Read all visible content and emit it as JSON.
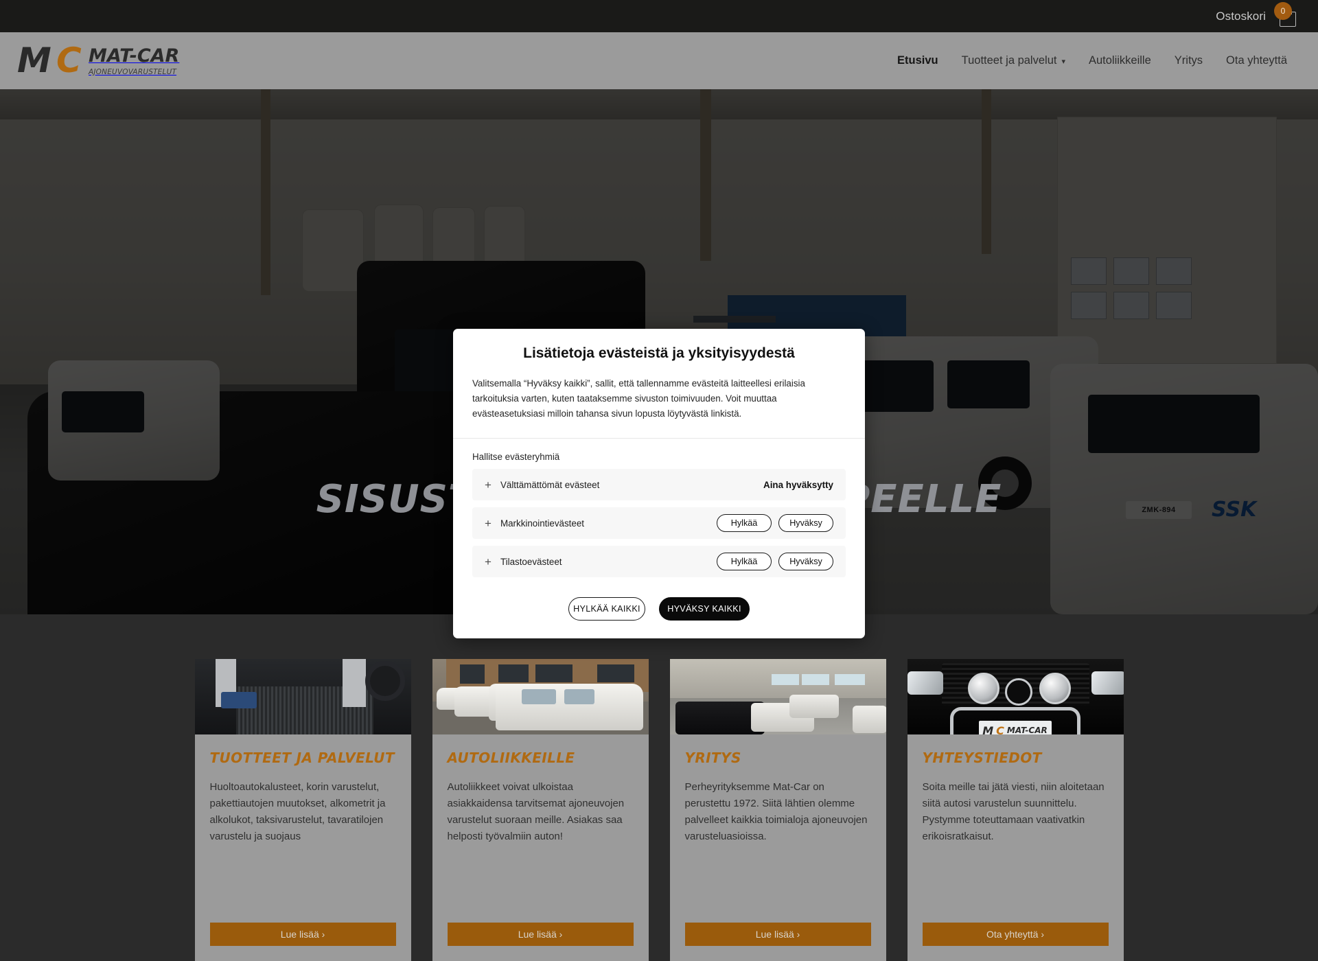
{
  "topbar": {
    "cart_label": "Ostoskori",
    "cart_count": "0",
    "cart_icon": "shopping-bag-icon",
    "background": "#1a1a18",
    "badge_color": "#a25b10"
  },
  "header": {
    "logo": {
      "mark_m": "M",
      "mark_c": "C",
      "name": "MAT-CAR",
      "tagline": "AJONEUVOVARUSTELUT",
      "accent": "#b06a12"
    },
    "background": "#9b9b9b",
    "nav": [
      {
        "label": "Etusivu",
        "active": true,
        "has_dropdown": false
      },
      {
        "label": "Tuotteet ja palvelut",
        "active": false,
        "has_dropdown": true
      },
      {
        "label": "Autoliikkeille",
        "active": false,
        "has_dropdown": false
      },
      {
        "label": "Yritys",
        "active": false,
        "has_dropdown": false
      },
      {
        "label": "Ota yhteyttä",
        "active": false,
        "has_dropdown": false
      }
    ],
    "chevron_icon": "chevron-down-icon"
  },
  "hero": {
    "title_visible_left": "SIS",
    "title_visible_right": "LLE",
    "title_full": "SISUSTUKSET JOKA TARPEELLE",
    "van_plate": "ZMK-894",
    "van_brand_text": "SSK",
    "overlay_color": "rgba(0,0,0,0.70)"
  },
  "cookie_dialog": {
    "title": "Lisätietoja evästeistä ja yksityisyydestä",
    "body": "Valitsemalla “Hyväksy kaikki”, sallit, että tallennamme evästeitä laitteellesi erilaisia tarkoituksia varten, kuten taataksemme sivuston toimivuuden. Voit muuttaa evästeasetuksiasi milloin tahansa sivun lopusta löytyvästä linkistä.",
    "manage_label": "Hallitse evästeryhmiä",
    "expand_icon": "plus-icon",
    "groups": [
      {
        "label": "Välttämättömät evästeet",
        "status": "Aina hyväksytty",
        "has_buttons": false,
        "reject_label": "",
        "accept_label": ""
      },
      {
        "label": "Markkinointievästeet",
        "status": "",
        "has_buttons": true,
        "reject_label": "Hylkää",
        "accept_label": "Hyväksy"
      },
      {
        "label": "Tilastoevästeet",
        "status": "",
        "has_buttons": true,
        "reject_label": "Hylkää",
        "accept_label": "Hyväksy"
      }
    ],
    "reject_all_label": "HYLKÄÄ KAIKKI",
    "accept_all_label": "HYVÄKSY KAIKKI"
  },
  "cards": [
    {
      "title": "TUOTTEET JA PALVELUT",
      "text": "Huoltoautokalusteet, korin varustelut, pakettiautojen muutokset, alkometrit ja alkolukot, taksivarustelut, tavaratilojen varustelu ja suojaus",
      "button": "Lue lisää ›",
      "image_name": "van-cargo-interior-photo"
    },
    {
      "title": "AUTOLIIKKEILLE",
      "text": "Autoliikkeet voivat ulkoistaa asiakkaidensa tarvitsemat ajoneuvojen varustelut suoraan meille. Asiakas saa helposti työvalmiin auton!",
      "button": "Lue lisää ›",
      "image_name": "white-van-fleet-photo"
    },
    {
      "title": "YRITYS",
      "text": "Perheyrityksemme Mat-Car on perustettu 1972. Siitä lähtien olemme palvelleet kaikkia toimialoja ajoneuvojen varusteluasioissa.",
      "button": "Lue lisää ›",
      "image_name": "workshop-interior-photo"
    },
    {
      "title": "YHTEYSTIEDOT",
      "text": "Soita meille tai jätä viesti, niin aloitetaan siitä autosi varustelun suunnittelu. Pystymme toteuttamaan vaativatkin erikoisratkaisut.",
      "button": "Ota yhteyttä ›",
      "image_name": "mercedes-bullbar-photo",
      "plate_m": "M",
      "plate_c": "C",
      "plate_name": "MAT-CAR",
      "plate_sub": "AJONEUVOVARUSTELUT"
    }
  ],
  "colors": {
    "brand_orange": "#b06a12",
    "button_orange": "#9a5b0c",
    "card_gray": "#9b9b9b",
    "dark": "#1a1a18"
  }
}
